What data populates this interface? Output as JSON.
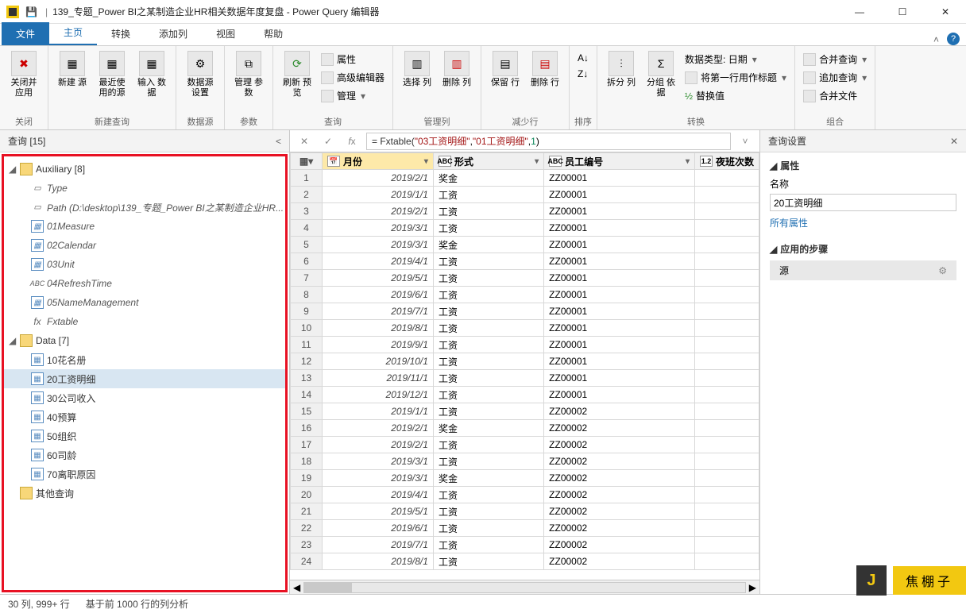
{
  "title": "139_专题_Power BI之某制造企业HR相关数据年度复盘 - Power Query 编辑器",
  "tabs": {
    "file": "文件",
    "home": "主页",
    "transform": "转换",
    "addcol": "添加列",
    "view": "视图",
    "help": "帮助"
  },
  "ribbon": {
    "close": {
      "label": "关闭并\n应用",
      "group": "关闭"
    },
    "newquery": {
      "newsrc": "新建\n源",
      "recent": "最近使\n用的源",
      "enter": "输入\n数据",
      "group": "新建查询"
    },
    "datasrc": {
      "settings": "数据源\n设置",
      "group": "数据源"
    },
    "params": {
      "manage": "管理\n参数",
      "group": "参数"
    },
    "query": {
      "refresh": "刷新\n预览",
      "props": "属性",
      "adv": "高级编辑器",
      "mng": "管理",
      "group": "查询"
    },
    "cols": {
      "choose": "选择\n列",
      "remove": "删除\n列",
      "group": "管理列"
    },
    "rows": {
      "keep": "保留\n行",
      "remove": "删除\n行",
      "group": "减少行"
    },
    "sort": {
      "group": "排序"
    },
    "transform": {
      "split": "拆分\n列",
      "groupby": "分组\n依据",
      "dtype": "数据类型: 日期",
      "firstrow": "将第一行用作标题",
      "replace": "替换值",
      "group": "转换"
    },
    "combine": {
      "merge": "合并查询",
      "append": "追加查询",
      "files": "合并文件",
      "group": "组合"
    }
  },
  "queriesPane": {
    "header": "查询 [15]",
    "aux": "Auxiliary [8]",
    "auxItems": [
      {
        "n": "Type",
        "ico": "doc"
      },
      {
        "n": "Path (D:\\desktop\\139_专题_Power BI之某制造企业HR...",
        "ico": "doc"
      },
      {
        "n": "01Measure",
        "ico": "tbl"
      },
      {
        "n": "02Calendar",
        "ico": "tbl"
      },
      {
        "n": "03Unit",
        "ico": "tbl"
      },
      {
        "n": "04RefreshTime",
        "ico": "abc"
      },
      {
        "n": "05NameManagement",
        "ico": "tbl"
      },
      {
        "n": "Fxtable",
        "ico": "fx"
      }
    ],
    "dataFolder": "Data [7]",
    "dataItems": [
      {
        "n": "10花名册"
      },
      {
        "n": "20工资明细",
        "sel": true
      },
      {
        "n": "30公司收入"
      },
      {
        "n": "40预算"
      },
      {
        "n": "50组织"
      },
      {
        "n": "60司龄"
      },
      {
        "n": "70离职原因"
      }
    ],
    "other": "其他查询"
  },
  "formula": {
    "fn": "= Fxtable(",
    "s1": "\"03工资明细\"",
    "c": ",",
    "s2": "\"01工资明细\"",
    "c2": ",",
    "n": "1",
    "end": ")"
  },
  "columns": {
    "month": "月份",
    "form": "形式",
    "emp": "员工编号",
    "night": "夜班次数"
  },
  "rows": [
    {
      "d": "2019/2/1",
      "f": "奖金",
      "e": "ZZ00001"
    },
    {
      "d": "2019/1/1",
      "f": "工资",
      "e": "ZZ00001"
    },
    {
      "d": "2019/2/1",
      "f": "工资",
      "e": "ZZ00001"
    },
    {
      "d": "2019/3/1",
      "f": "工资",
      "e": "ZZ00001"
    },
    {
      "d": "2019/3/1",
      "f": "奖金",
      "e": "ZZ00001"
    },
    {
      "d": "2019/4/1",
      "f": "工资",
      "e": "ZZ00001"
    },
    {
      "d": "2019/5/1",
      "f": "工资",
      "e": "ZZ00001"
    },
    {
      "d": "2019/6/1",
      "f": "工资",
      "e": "ZZ00001"
    },
    {
      "d": "2019/7/1",
      "f": "工资",
      "e": "ZZ00001"
    },
    {
      "d": "2019/8/1",
      "f": "工资",
      "e": "ZZ00001"
    },
    {
      "d": "2019/9/1",
      "f": "工资",
      "e": "ZZ00001"
    },
    {
      "d": "2019/10/1",
      "f": "工资",
      "e": "ZZ00001"
    },
    {
      "d": "2019/11/1",
      "f": "工资",
      "e": "ZZ00001"
    },
    {
      "d": "2019/12/1",
      "f": "工资",
      "e": "ZZ00001"
    },
    {
      "d": "2019/1/1",
      "f": "工资",
      "e": "ZZ00002"
    },
    {
      "d": "2019/2/1",
      "f": "奖金",
      "e": "ZZ00002"
    },
    {
      "d": "2019/2/1",
      "f": "工资",
      "e": "ZZ00002"
    },
    {
      "d": "2019/3/1",
      "f": "工资",
      "e": "ZZ00002"
    },
    {
      "d": "2019/3/1",
      "f": "奖金",
      "e": "ZZ00002"
    },
    {
      "d": "2019/4/1",
      "f": "工资",
      "e": "ZZ00002"
    },
    {
      "d": "2019/5/1",
      "f": "工资",
      "e": "ZZ00002"
    },
    {
      "d": "2019/6/1",
      "f": "工资",
      "e": "ZZ00002"
    },
    {
      "d": "2019/7/1",
      "f": "工资",
      "e": "ZZ00002"
    },
    {
      "d": "2019/8/1",
      "f": "工资",
      "e": "ZZ00002"
    }
  ],
  "settings": {
    "header": "查询设置",
    "props": "属性",
    "nameLabel": "名称",
    "nameValue": "20工资明细",
    "allProps": "所有属性",
    "stepsHeader": "应用的步骤",
    "step1": "源"
  },
  "status": {
    "cols": "30 列, 999+ 行",
    "profile": "基于前 1000 行的列分析"
  },
  "watermark": {
    "logo": "J",
    "text": "焦棚子"
  }
}
